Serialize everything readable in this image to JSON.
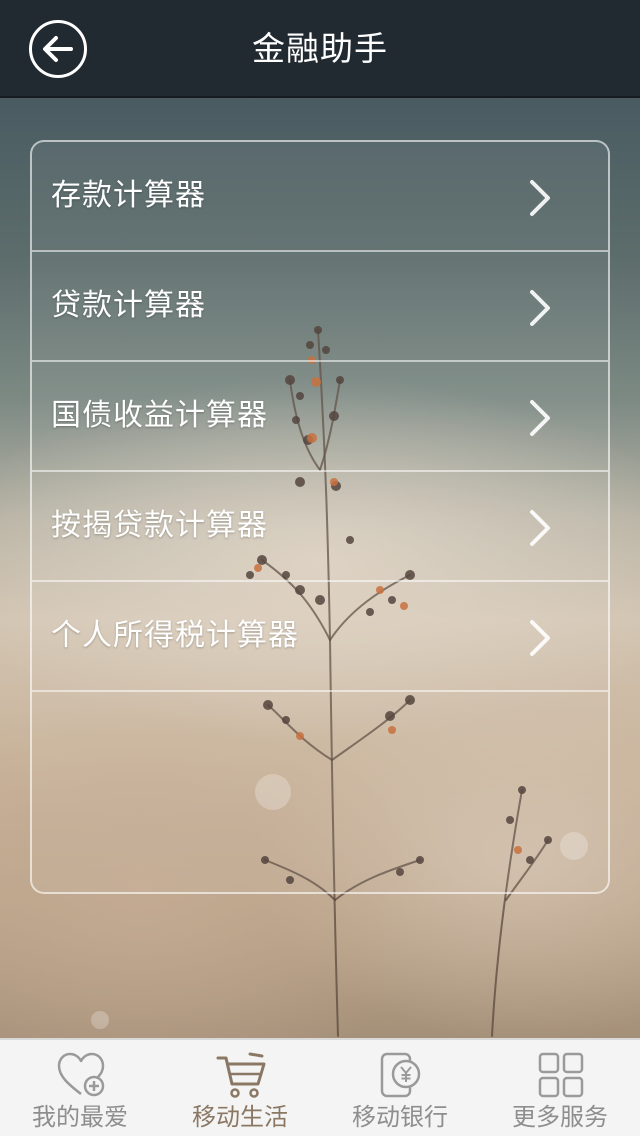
{
  "header": {
    "title": "金融助手",
    "back_icon": "arrow-left-circle-icon"
  },
  "menu": {
    "items": [
      {
        "label": "存款计算器",
        "icon": "chevron-right-icon"
      },
      {
        "label": "贷款计算器",
        "icon": "chevron-right-icon"
      },
      {
        "label": "国债收益计算器",
        "icon": "chevron-right-icon"
      },
      {
        "label": "按揭贷款计算器",
        "icon": "chevron-right-icon"
      },
      {
        "label": "个人所得税计算器",
        "icon": "chevron-right-icon"
      }
    ]
  },
  "tabbar": {
    "active": "移动生活",
    "tabs": [
      {
        "label": "我的最爱",
        "icon": "heart-plus-icon"
      },
      {
        "label": "移动生活",
        "icon": "shopping-cart-icon"
      },
      {
        "label": "移动银行",
        "icon": "yuan-phone-icon"
      },
      {
        "label": "更多服务",
        "icon": "grid-icon"
      }
    ]
  },
  "colors": {
    "header_bg": "#1e262e",
    "tabbar_bg": "#f4f4f4",
    "active_tab": "#8a7764",
    "inactive_tab": "#8e8e8e",
    "menu_text": "#ffffff"
  }
}
